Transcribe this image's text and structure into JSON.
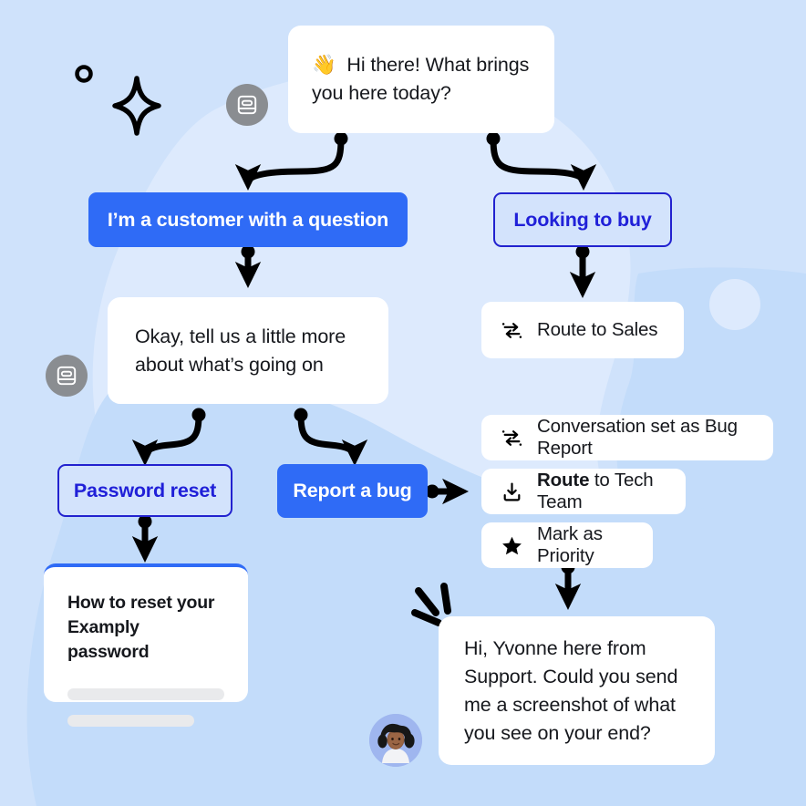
{
  "theme": {
    "background": "#cfe2fb",
    "blob_light": "#ddeafd",
    "blob_mid": "#c3dcfa",
    "accent_blue": "#2f6bf6",
    "outline_blue": "#2222cf",
    "outline_fill": "#d3e3fc",
    "card_white": "#ffffff",
    "text_dark": "#16181d",
    "avatar_gray": "#8a8d91",
    "skeleton_gray": "#e9eaec"
  },
  "flow": {
    "greeting": {
      "emoji": "👋",
      "text": "Hi there! What brings you here today?",
      "avatar_icon": "chat-bot-icon"
    },
    "choices_level1": [
      {
        "label": "I’m a customer with a question",
        "style": "filled"
      },
      {
        "label": "Looking to buy",
        "style": "outlined"
      }
    ],
    "sales_action": {
      "label": "Route to Sales",
      "icon": "route-arrows-icon"
    },
    "followup": {
      "text": "Okay, tell us a little more about what’s going on",
      "avatar_icon": "chat-bot-icon"
    },
    "choices_level2": [
      {
        "label": "Password reset",
        "style": "outlined"
      },
      {
        "label": "Report a bug",
        "style": "filled"
      }
    ],
    "bug_actions": [
      {
        "label": "Conversation set as Bug Report",
        "icon": "route-arrows-icon",
        "bold_prefix": ""
      },
      {
        "label": " to Tech Team",
        "icon": "route-download-icon",
        "bold_prefix": "Route"
      },
      {
        "label": "Mark as Priority",
        "icon": "star-icon",
        "bold_prefix": ""
      }
    ],
    "article": {
      "title": "How to reset your Examply password",
      "skeleton_lines": 2
    },
    "agent_message": {
      "text": "Hi, Yvonne here from Support. Could you send me a screenshot of what you see on your end?",
      "avatar_name": "agent-photo-avatar"
    }
  },
  "decorations": {
    "circle_outline": "circle-outline-decor",
    "sparkle_star": "sparkle-star-decor",
    "speech_lines": "speech-burst-decor"
  }
}
